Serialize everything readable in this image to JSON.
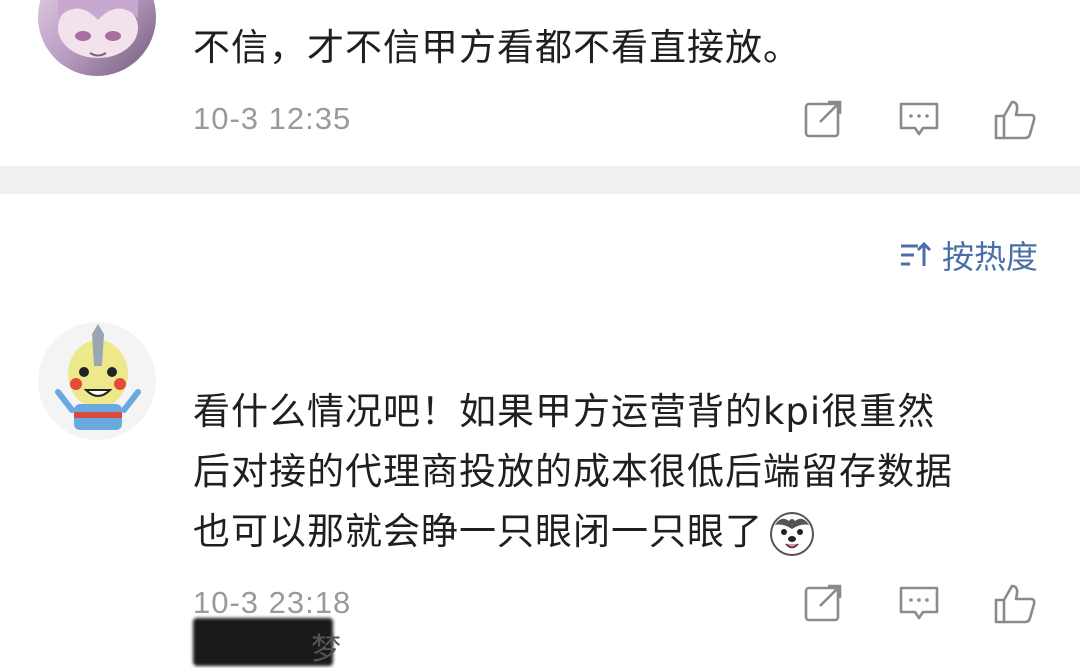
{
  "comments": [
    {
      "text": "不信，才不信甲方看都不看直接放。",
      "timestamp": "10-3 12:35",
      "actions": [
        "share-icon",
        "reply-icon",
        "like-icon"
      ]
    },
    {
      "username_suffix": "梦",
      "text_lines": [
        "看什么情况吧！如果甲方运营背的kpi很重然",
        "后对接的代理商投放的成本很低后端留存数据",
        "也可以那就会睁一只眼闭一只眼了"
      ],
      "emoji": "husky-face-emoji",
      "timestamp": "10-3 23:18",
      "actions": [
        "share-icon",
        "reply-icon",
        "like-icon"
      ]
    }
  ],
  "sort": {
    "label": "按热度",
    "icon": "sort-icon"
  },
  "colors": {
    "text": "#1f1f1f",
    "meta": "#9a9a9a",
    "accent": "#4a6fa8",
    "divider": "#f1f1f1"
  }
}
